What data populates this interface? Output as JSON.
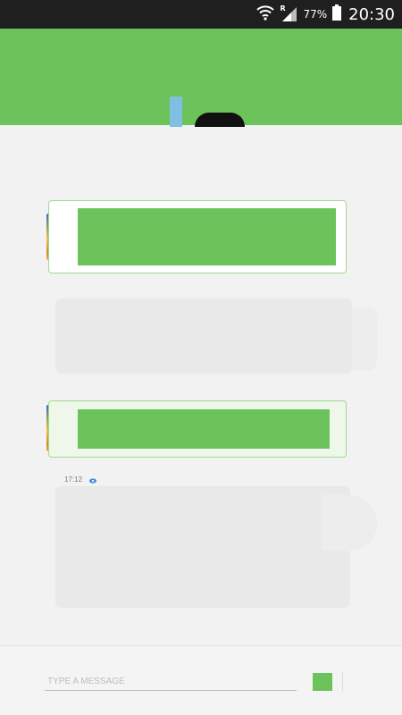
{
  "status_bar": {
    "roaming_indicator": "R",
    "battery_percent": "77%",
    "time": "20:30",
    "icons": [
      "wifi-icon",
      "signal-icon",
      "battery-icon"
    ]
  },
  "colors": {
    "accent": "#6cc35b",
    "status_bar": "#1f1f1f",
    "background": "#f2f2f2",
    "incoming_bubble": "#e9e9e9",
    "read_receipt": "#3d8fe0"
  },
  "chat": {
    "messages": [
      {
        "direction": "outgoing",
        "has_avatar": true
      },
      {
        "direction": "incoming"
      },
      {
        "direction": "outgoing",
        "has_avatar": true,
        "time": "17:12",
        "status_icon": "eye-icon"
      },
      {
        "direction": "incoming"
      }
    ]
  },
  "composer": {
    "placeholder": "TYPE A MESSAGE",
    "value": "",
    "send_icon": "send-icon"
  }
}
